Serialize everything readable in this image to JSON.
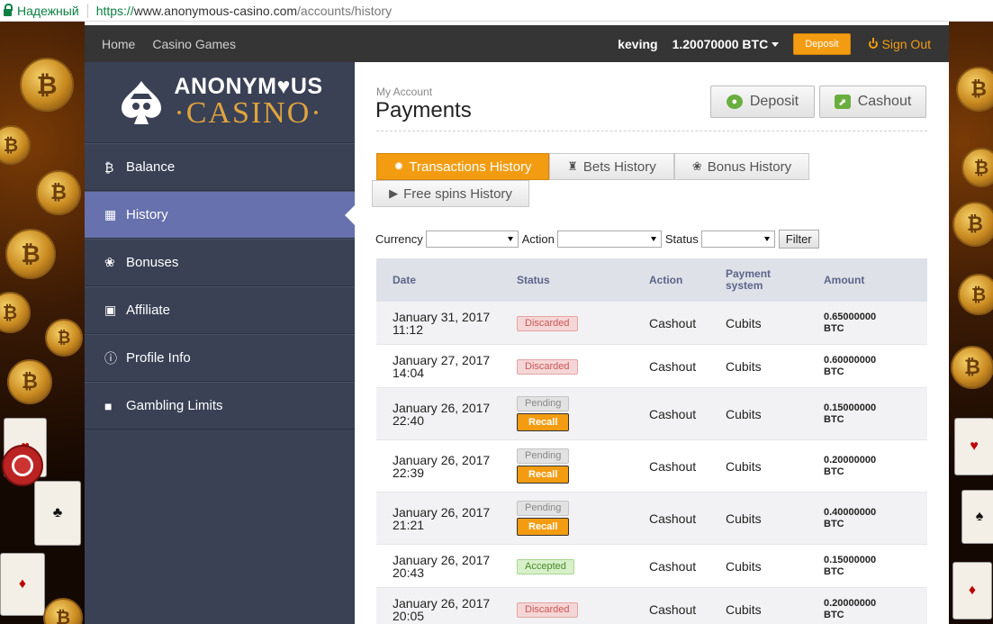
{
  "browser": {
    "secure_label": "Надежный",
    "url_scheme": "https://",
    "url_host": "www.anonymous-casino.com",
    "url_path": "/accounts/history"
  },
  "topnav": {
    "home": "Home",
    "casino_games": "Casino Games",
    "username": "keving",
    "balance": "1.20070000 BTC",
    "deposit": "Deposit",
    "signout": "Sign Out"
  },
  "logo": {
    "line1": "ANONYM♥US",
    "line2": "·CASINO·"
  },
  "sidebar": {
    "items": [
      {
        "label": "Balance",
        "icon": "bitcoin-icon",
        "glyph": "₿"
      },
      {
        "label": "History",
        "icon": "calendar-icon",
        "glyph": "▦"
      },
      {
        "label": "Bonuses",
        "icon": "gift-icon",
        "glyph": "❀"
      },
      {
        "label": "Affiliate",
        "icon": "briefcase-icon",
        "glyph": "▣"
      },
      {
        "label": "Profile Info",
        "icon": "info-icon",
        "glyph": "ⓘ"
      },
      {
        "label": "Gambling Limits",
        "icon": "lock-icon",
        "glyph": "■"
      }
    ],
    "active": "History"
  },
  "main": {
    "breadcrumb": "My Account",
    "title": "Payments",
    "deposit_btn": "Deposit",
    "cashout_btn": "Cashout"
  },
  "tabs": {
    "transactions": "Transactions History",
    "bets": "Bets History",
    "bonus": "Bonus History",
    "freespins": "Free spins History"
  },
  "filters": {
    "currency": "Currency",
    "action": "Action",
    "status": "Status",
    "filter_btn": "Filter"
  },
  "table": {
    "headers": {
      "date": "Date",
      "status": "Status",
      "action": "Action",
      "payment_line1": "Payment",
      "payment_line2": "system",
      "amount": "Amount"
    },
    "recall_label": "Recall",
    "rows": [
      {
        "date": "January 31, 2017",
        "time": "11:12",
        "status": "Discarded",
        "recall": false,
        "action": "Cashout",
        "payment": "Cubits",
        "amount": "0.65000000",
        "unit": "BTC"
      },
      {
        "date": "January 27, 2017",
        "time": "14:04",
        "status": "Discarded",
        "recall": false,
        "action": "Cashout",
        "payment": "Cubits",
        "amount": "0.60000000",
        "unit": "BTC"
      },
      {
        "date": "January 26, 2017",
        "time": "22:40",
        "status": "Pending",
        "recall": true,
        "action": "Cashout",
        "payment": "Cubits",
        "amount": "0.15000000",
        "unit": "BTC"
      },
      {
        "date": "January 26, 2017",
        "time": "22:39",
        "status": "Pending",
        "recall": true,
        "action": "Cashout",
        "payment": "Cubits",
        "amount": "0.20000000",
        "unit": "BTC"
      },
      {
        "date": "January 26, 2017",
        "time": "21:21",
        "status": "Pending",
        "recall": true,
        "action": "Cashout",
        "payment": "Cubits",
        "amount": "0.40000000",
        "unit": "BTC"
      },
      {
        "date": "January 26, 2017",
        "time": "20:43",
        "status": "Accepted",
        "recall": false,
        "action": "Cashout",
        "payment": "Cubits",
        "amount": "0.15000000",
        "unit": "BTC"
      },
      {
        "date": "January 26, 2017",
        "time": "20:05",
        "status": "Discarded",
        "recall": false,
        "action": "Cashout",
        "payment": "Cubits",
        "amount": "0.20000000",
        "unit": "BTC"
      }
    ]
  },
  "colors": {
    "accent": "#f39c12",
    "sidebar": "#3a4155",
    "sidebar_active": "#6671ad",
    "topnav": "#353535"
  }
}
